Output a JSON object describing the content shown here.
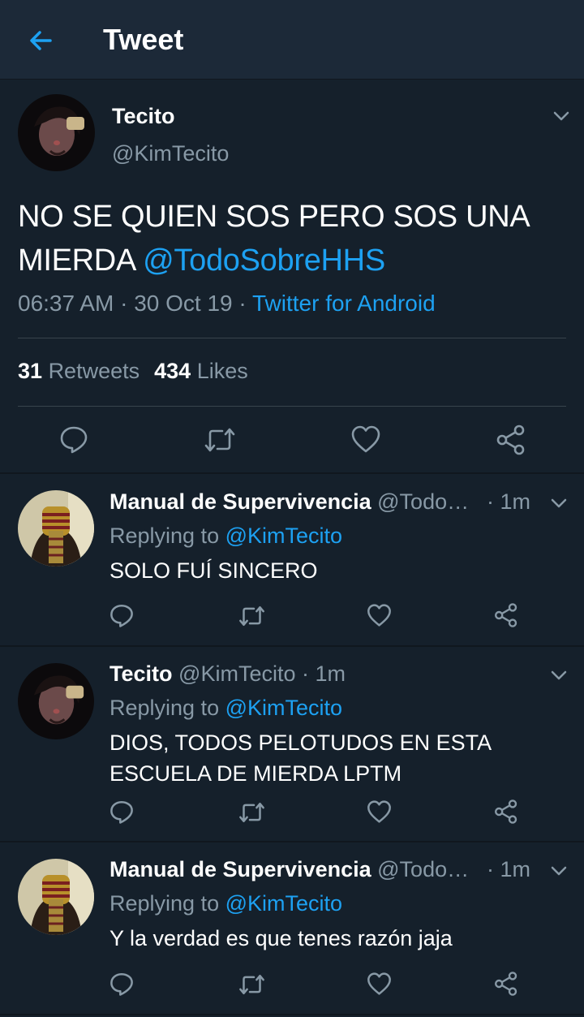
{
  "header": {
    "title": "Tweet"
  },
  "main": {
    "name": "Tecito",
    "handle": "@KimTecito",
    "text_plain": "NO SE QUIEN SOS PERO SOS UNA MIERDA ",
    "text_mention": "@TodoSobreHHS",
    "time": "06:37 AM",
    "dot1": " · ",
    "date": "30 Oct 19",
    "dot2": " · ",
    "source": "Twitter for Android",
    "retweets_count": "31",
    "retweets_label": "Retweets",
    "likes_count": "434",
    "likes_label": "Likes"
  },
  "replies": [
    {
      "name": "Manual de Supervivencia",
      "handle": "@Todo…",
      "time": "· 1m",
      "replying_label": "Replying to ",
      "replying_to": "@KimTecito",
      "text": "SOLO FUÍ SINCERO"
    },
    {
      "name": "Tecito",
      "handle": "@KimTecito",
      "time": "· 1m",
      "replying_label": "Replying to ",
      "replying_to": "@KimTecito",
      "text": "DIOS, TODOS PELOTUDOS EN ESTA ESCUELA DE MIERDA LPTM"
    },
    {
      "name": "Manual de Supervivencia",
      "handle": "@Todo…",
      "time": "· 1m",
      "replying_label": "Replying to ",
      "replying_to": "@KimTecito",
      "text": "Y la verdad es que tenes razón jaja"
    }
  ],
  "colors": {
    "background": "#15202b",
    "header": "#1c2938",
    "accent": "#1da1f2",
    "secondary": "#8899a6"
  },
  "icons": [
    "back-arrow-icon",
    "chevron-down-icon",
    "reply-icon",
    "retweet-icon",
    "like-icon",
    "share-icon"
  ]
}
